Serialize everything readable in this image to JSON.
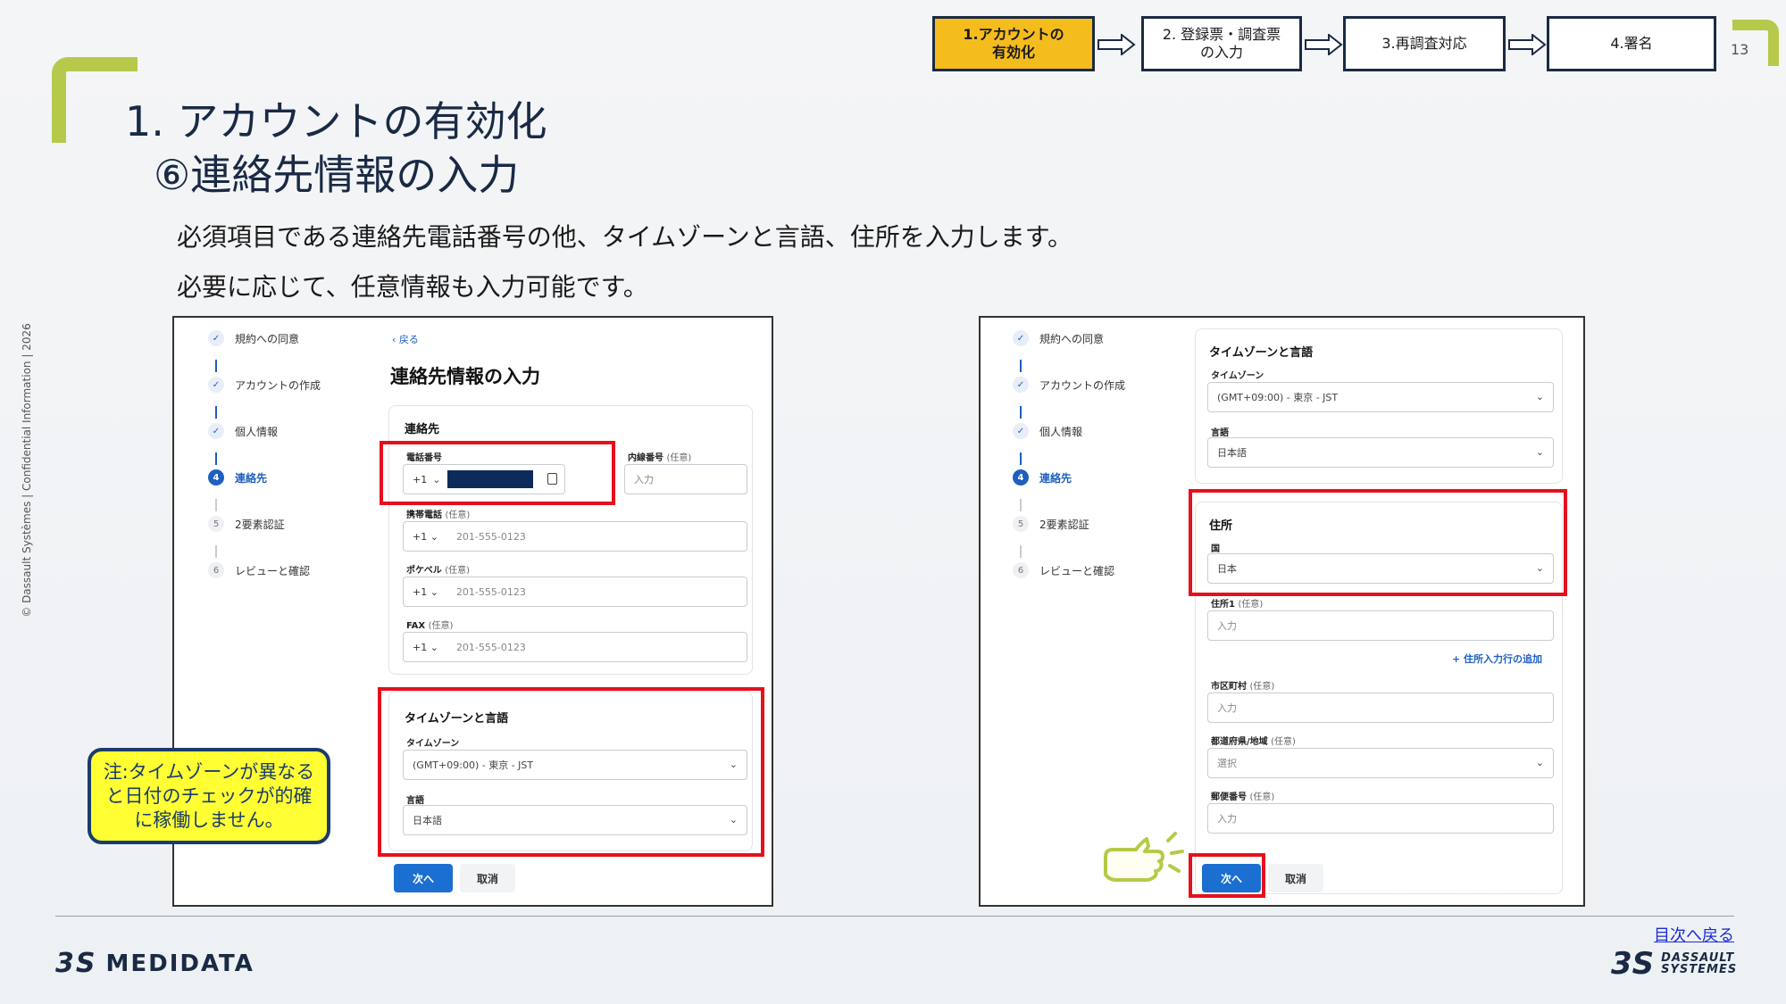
{
  "flow": {
    "steps": [
      "1.アカウントの\n有効化",
      "2. 登録票・調査票\nの入力",
      "3.再調査対応",
      "4.署名"
    ]
  },
  "page_number": "13",
  "title": {
    "line1": "1. アカウントの有効化",
    "line2": "⑥連絡先情報の入力"
  },
  "description": {
    "line1": "必須項目である連絡先電話番号の他、タイムゾーンと言語、住所を入力します。",
    "line2": "必要に応じて、任意情報も入力可能です。"
  },
  "confidential": "© Dassault Systèmes | Confidential Information | 2026",
  "stepper": {
    "items": [
      "規約への同意",
      "アカウントの作成",
      "個人情報",
      "連絡先",
      "2要素認証",
      "レビューと確認"
    ],
    "numbers": [
      "4",
      "5",
      "6"
    ]
  },
  "left_form": {
    "back": "‹ 戻る",
    "heading": "連絡先情報の入力",
    "contact_title": "連絡先",
    "phone_label": "電話番号",
    "extension_label": "内線番号",
    "optional": "(任意)",
    "extension_placeholder": "入力",
    "mobile_label": "携帯電話",
    "pager_label": "ポケベル",
    "fax_label": "FAX",
    "country_code": "+1",
    "phone_placeholder": "201-555-0123",
    "tz_title": "タイムゾーンと言語",
    "tz_label": "タイムゾーン",
    "tz_value": "(GMT+09:00) - 東京 - JST",
    "lang_label": "言語",
    "lang_value": "日本語",
    "next_button": "次へ",
    "cancel_button": "取消"
  },
  "right_form": {
    "tz_title": "タイムゾーンと言語",
    "tz_label": "タイムゾーン",
    "tz_value": "(GMT+09:00) - 東京 - JST",
    "lang_label": "言語",
    "lang_value": "日本語",
    "address_title": "住所",
    "country_label": "国",
    "country_value": "日本",
    "address1_label": "住所1",
    "optional": "(任意)",
    "input_placeholder": "入力",
    "add_address_link": "+ 住所入力行の追加",
    "city_label": "市区町村",
    "prefecture_label": "都道府県/地域",
    "select_placeholder": "選択",
    "postal_label": "郵便番号",
    "next_button": "次へ",
    "cancel_button": "取消"
  },
  "note": "注:タイムゾーンが異なると日付のチェックが的確に稼働しません。",
  "toc_link": "目次へ戻る",
  "logos": {
    "medidata": "MEDIDATA",
    "ds_mark": "3S",
    "dassault": "DASSAULT\nSYSTEMES"
  },
  "colors": {
    "active_step": "#f5bc1d",
    "highlight": "#e6101c",
    "note_bg": "#ffff33",
    "primary_button": "#1a6fd1",
    "accent_green": "#b6c94a"
  }
}
